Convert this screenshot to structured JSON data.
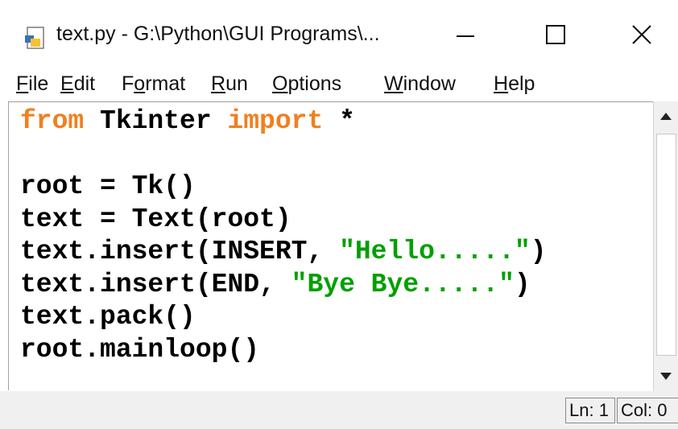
{
  "window": {
    "title": "text.py - G:\\Python\\GUI Programs\\...",
    "controls": {
      "minimize": "—",
      "maximize": "☐",
      "close": "✕"
    }
  },
  "menu": {
    "items": [
      {
        "label": "File",
        "underline": "F",
        "rest": "ile"
      },
      {
        "label": "Edit",
        "underline": "E",
        "rest": "dit"
      },
      {
        "label": "Format",
        "pre": "F",
        "underline": "o",
        "rest": "rmat"
      },
      {
        "label": "Run",
        "underline": "R",
        "rest": "un"
      },
      {
        "label": "Options",
        "underline": "O",
        "rest": "ptions"
      },
      {
        "label": "Window",
        "underline": "W",
        "rest": "indow"
      },
      {
        "label": "Help",
        "underline": "H",
        "rest": "elp"
      }
    ]
  },
  "editor": {
    "lines": [
      [
        {
          "t": "from",
          "c": "kw"
        },
        {
          "t": " Tkinter "
        },
        {
          "t": "import",
          "c": "kw"
        },
        {
          "t": " *"
        }
      ],
      [
        {
          "t": ""
        }
      ],
      [
        {
          "t": "root = Tk()"
        }
      ],
      [
        {
          "t": "text = Text(root)"
        }
      ],
      [
        {
          "t": "text.insert(INSERT, "
        },
        {
          "t": "\"Hello.....\"",
          "c": "str"
        },
        {
          "t": ")"
        }
      ],
      [
        {
          "t": "text.insert(END, "
        },
        {
          "t": "\"Bye Bye.....\"",
          "c": "str"
        },
        {
          "t": ")"
        }
      ],
      [
        {
          "t": "text.pack()"
        }
      ],
      [
        {
          "t": "root.mainloop()"
        }
      ]
    ],
    "colors": {
      "keyword": "#f08020",
      "string": "#00a000",
      "default": "#000000"
    }
  },
  "statusbar": {
    "line": "Ln: 1",
    "col": "Col: 0"
  },
  "icons": {
    "app": "python-file-icon",
    "scroll_up": "scroll-up-arrow-icon",
    "scroll_down": "scroll-down-arrow-icon"
  }
}
